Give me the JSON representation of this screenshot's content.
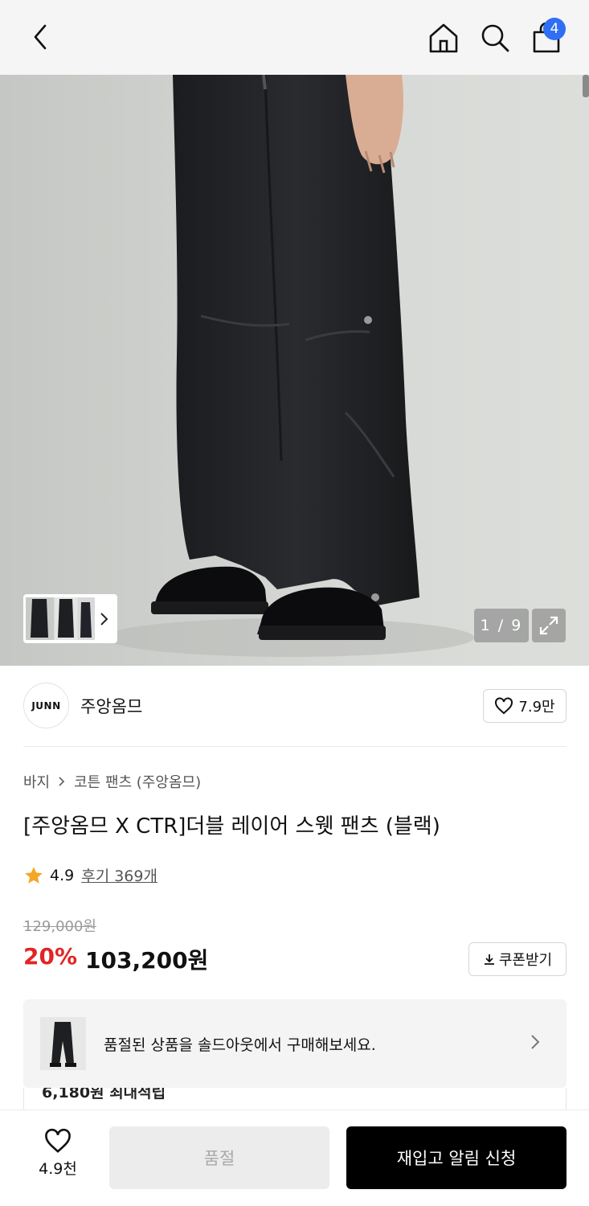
{
  "header": {
    "back_icon": "chevron-left-icon",
    "home_icon": "home-icon",
    "search_icon": "search-icon",
    "cart_icon": "shopping-bag-icon",
    "cart_count": "4",
    "badge_color": "#2f6ef5"
  },
  "gallery": {
    "counter": "1 / 9",
    "expand_icon": "expand-icon",
    "thumb_chevron_icon": "chevron-right-icon"
  },
  "brand": {
    "logo_text": "JUNN",
    "name": "주앙옴므",
    "like_count": "7.9만",
    "heart_icon": "heart-outline-icon"
  },
  "breadcrumb": {
    "level1": "바지",
    "level2": "코튼 팬츠 (주앙옴므)"
  },
  "product": {
    "title": "[주앙옴므 X CTR]더블 레이어 스웻 팬츠 (블랙)",
    "rating": "4.9",
    "reviews": "후기 369개",
    "star_color": "#f5a623",
    "original_price": "129,000원",
    "discount": "20%",
    "price": "103,200원",
    "discount_color": "#e32424",
    "coupon_label": "쿠폰받기"
  },
  "soldout_notice": {
    "message": "품절된 상품을 솔드아웃에서 구매해보세요."
  },
  "partial_text": "6,180원 최대적립",
  "bottom_bar": {
    "wish_count": "4.9천",
    "soldout_label": "품절",
    "restock_label": "재입고 알림 신청"
  }
}
